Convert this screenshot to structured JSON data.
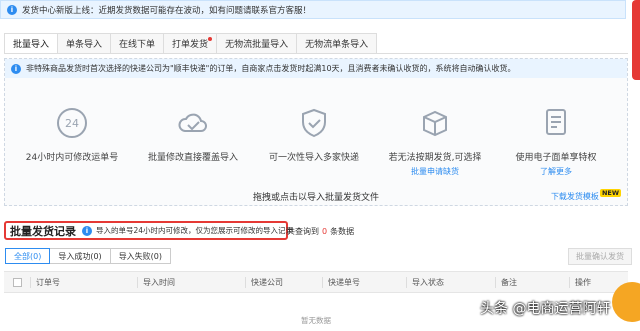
{
  "notice": {
    "text": "发货中心新版上线：近期发货数据可能存在波动，如有问题请联系官方客服！"
  },
  "tabs": [
    {
      "label": "批量导入",
      "active": true
    },
    {
      "label": "单条导入"
    },
    {
      "label": "在线下单"
    },
    {
      "label": "打单发货",
      "dot": true
    },
    {
      "label": "无物流批量导入"
    },
    {
      "label": "无物流单条导入"
    }
  ],
  "upload": {
    "tip": "非特殊商品发货时首次选择的快递公司为\"顺丰快递\"的订单，自商家点击发货时起满10天，且消费者未确认收货的，系统将自动确认收货。",
    "features": [
      {
        "icon": "clock-24-icon",
        "label": "24小时内可修改运单号"
      },
      {
        "icon": "cloud-check-icon",
        "label": "批量修改直接覆盖导入"
      },
      {
        "icon": "shield-check-icon",
        "label": "可一次性导入多家快递"
      },
      {
        "icon": "package-icon",
        "label": "若无法按期发货,可选择",
        "link": "批量申请缺货"
      },
      {
        "icon": "document-icon",
        "label": "使用电子面单享特权",
        "link": "了解更多"
      }
    ],
    "hint": "拖拽或点击以导入批量发货文件",
    "download": "下载发货模板",
    "new_badge": "NEW"
  },
  "records": {
    "title": "批量发货记录",
    "note": "导入的单号24小时内可修改，仅为您展示可修改的导入记录",
    "query_prefix": "共查询到",
    "query_count": "0",
    "query_suffix": "条数据"
  },
  "subtabs": [
    {
      "label": "全部(0)",
      "active": true
    },
    {
      "label": "导入成功(0)"
    },
    {
      "label": "导入失败(0)"
    }
  ],
  "batch_confirm": "批量确认发货",
  "table": {
    "columns": [
      "订单号",
      "导入时间",
      "快递公司",
      "快递单号",
      "导入状态",
      "备注",
      "操作"
    ],
    "empty": "暂无数据"
  },
  "watermark": "头条 @电商运营阿轩",
  "colors": {
    "accent": "#2d8cf0",
    "highlight": "#e53935",
    "new_badge": "#ffd400"
  }
}
